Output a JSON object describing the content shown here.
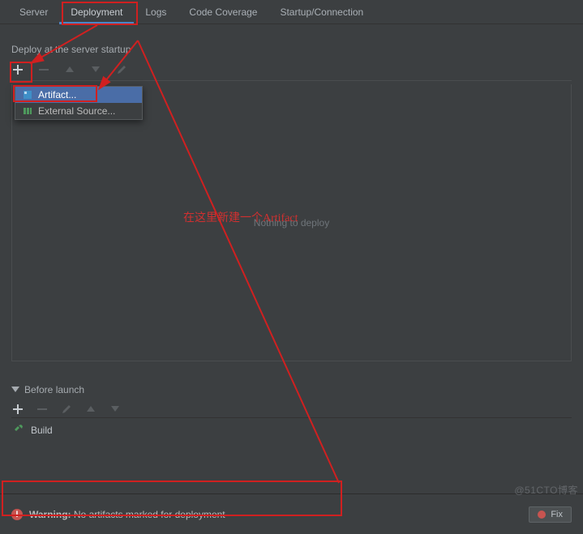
{
  "tabs": {
    "items": [
      "Server",
      "Deployment",
      "Logs",
      "Code Coverage",
      "Startup/Connection"
    ],
    "active_index": 1
  },
  "deploy_section_label": "Deploy at the server startup",
  "add_menu": {
    "artifact": "Artifact...",
    "external": "External Source..."
  },
  "main_empty_text": "Nothing to deploy",
  "annotation_text": "在这里新建一个Artifact",
  "before_launch": {
    "header": "Before launch",
    "build_label": "Build"
  },
  "footer": {
    "warning_label": "Warning:",
    "warning_msg": "No artifacts marked for deployment",
    "fix_label": "Fix"
  },
  "watermark": "@51CTO博客"
}
